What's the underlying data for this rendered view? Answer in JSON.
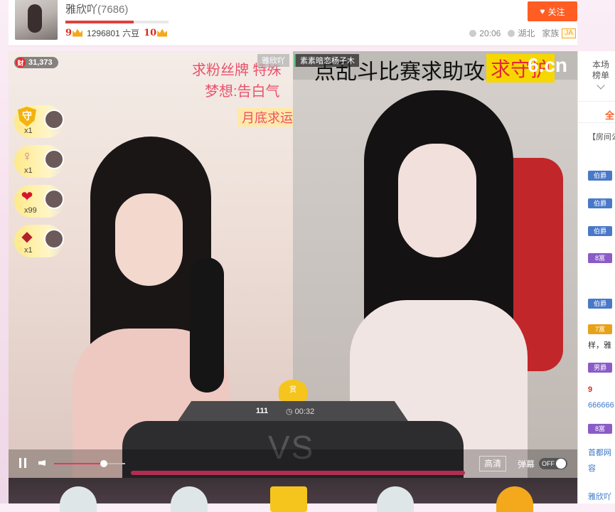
{
  "header": {
    "anchor_name": "雅欣吖",
    "room_id": "(7686)",
    "level_progress": 0.66,
    "level_current": "9",
    "level_next": "10",
    "beans": "1296801 六豆",
    "follow_label": "关注",
    "time": "20:06",
    "location": "湖北",
    "family_label": "家族",
    "family_badge": "JA"
  },
  "video": {
    "wealth_count": "31,373",
    "wealth_icon": "财",
    "left_name_tag": "雅欣吖",
    "right_name_tag": "素素暗恋杨子木",
    "left_overlay": [
      "求粉丝牌 特殊",
      "梦想:告白气",
      "月底求运"
    ],
    "right_banner": "点乱斗比赛求助攻",
    "right_guard": "求守护",
    "right_logo": "6.cn",
    "gifts": [
      {
        "icon": "shield-icon",
        "icon_text": "守",
        "count": "x1"
      },
      {
        "icon": "doll-icon",
        "icon_text": "",
        "count": "x1"
      },
      {
        "icon": "lips-icon",
        "icon_text": "",
        "count": "x99"
      },
      {
        "icon": "car-icon",
        "icon_text": "",
        "count": "x1"
      }
    ],
    "reward_label": "赏",
    "vs_score": "111",
    "vs_time": "00:32",
    "vs_text": "VS"
  },
  "controls": {
    "volume_level": 0.7,
    "quality_label": "高清",
    "danmaku_label": "弹幕",
    "toggle_label": "OFF"
  },
  "sidebar": {
    "rank_line1": "本场",
    "rank_line2": "榜单",
    "tab_label": "全",
    "notice": "【房间公",
    "entries": [
      {
        "badge": "伯爵",
        "color": "#4a78c8"
      },
      {
        "badge": "伯爵",
        "color": "#4a78c8"
      },
      {
        "badge": "伯爵",
        "color": "#4a78c8"
      },
      {
        "badge": "8富",
        "color": "#8b5cc8"
      },
      {
        "badge": "伯爵",
        "color": "#4a78c8"
      },
      {
        "badge": "7富",
        "color": "#e6a21a"
      },
      {
        "badge": "男爵",
        "color": "#8b5cc8"
      },
      {
        "badge": "8富",
        "color": "#8b5cc8"
      }
    ],
    "texts": [
      "样，雅",
      "9",
      "666666",
      "首都网",
      "容",
      "雅欣吖"
    ]
  }
}
